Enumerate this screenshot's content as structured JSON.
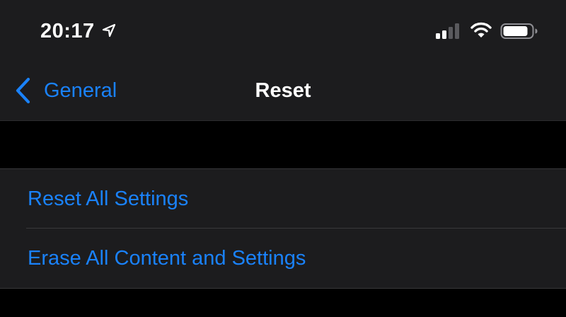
{
  "status_bar": {
    "time": "20:17",
    "location_icon": "location-arrow-icon",
    "signal_icon": "cellular-signal-icon",
    "signal_bars_active": 2,
    "signal_bars_total": 4,
    "wifi_icon": "wifi-icon",
    "battery_icon": "battery-icon",
    "battery_level": 0.85
  },
  "nav": {
    "back_label": "General",
    "back_icon": "chevron-left-icon",
    "title": "Reset"
  },
  "reset_options": [
    {
      "label": "Reset All Settings"
    },
    {
      "label": "Erase All Content and Settings"
    }
  ],
  "colors": {
    "accent": "#1a82fb",
    "background": "#000000",
    "surface": "#1c1c1e",
    "separator": "#38383a",
    "text_primary": "#ffffff"
  }
}
